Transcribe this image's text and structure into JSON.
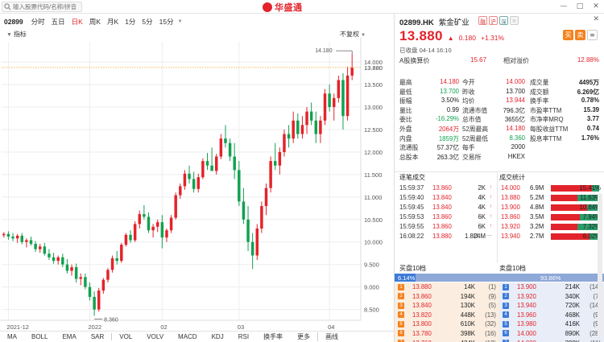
{
  "search": {
    "placeholder": "输入股票代码/名称/拼音"
  },
  "logo": {
    "text": "华盛通"
  },
  "window_controls": {
    "minimize": "—",
    "maximize": "□",
    "close": "✕"
  },
  "toolbar": {
    "code": "02899",
    "tabs": [
      "分时",
      "五日",
      "日K",
      "周K",
      "月K",
      "1分",
      "5分",
      "15分"
    ],
    "active_tab": "日K"
  },
  "subbar": {
    "tag": "指标",
    "adjust": "不复权"
  },
  "chart_data": {
    "type": "candlestick",
    "y_ticks": [
      8.5,
      9.0,
      9.5,
      10.0,
      10.5,
      11.0,
      11.5,
      12.0,
      12.5,
      13.0,
      13.5,
      14.0
    ],
    "ylim": [
      8.26,
      14.45
    ],
    "x_labels": [
      {
        "label": "2021-12",
        "i": 1
      },
      {
        "label": "2022",
        "i": 19
      },
      {
        "label": "02",
        "i": 35
      },
      {
        "label": "03",
        "i": 52
      },
      {
        "label": "04",
        "i": 72
      }
    ],
    "annotations": {
      "high": "14.180",
      "low": "8.360",
      "last": "13.880"
    },
    "candles": [
      [
        10.15,
        10.22,
        10.1,
        10.18
      ],
      [
        10.18,
        10.24,
        10.05,
        10.12
      ],
      [
        10.12,
        10.2,
        10.02,
        10.08
      ],
      [
        10.08,
        10.18,
        9.98,
        10.14
      ],
      [
        10.14,
        10.2,
        9.95,
        10.0
      ],
      [
        10.0,
        10.08,
        9.88,
        10.04
      ],
      [
        10.04,
        10.12,
        9.92,
        9.96
      ],
      [
        9.96,
        10.02,
        9.78,
        9.84
      ],
      [
        9.84,
        9.96,
        9.76,
        9.9
      ],
      [
        9.9,
        9.98,
        9.7,
        9.74
      ],
      [
        9.74,
        9.84,
        9.6,
        9.66
      ],
      [
        9.66,
        9.76,
        9.52,
        9.58
      ],
      [
        9.58,
        9.7,
        9.5,
        9.66
      ],
      [
        9.66,
        9.74,
        9.44,
        9.5
      ],
      [
        9.5,
        9.62,
        9.3,
        9.36
      ],
      [
        9.36,
        9.5,
        9.25,
        9.44
      ],
      [
        9.44,
        9.52,
        9.1,
        9.18
      ],
      [
        9.18,
        9.3,
        9.04,
        9.22
      ],
      [
        9.22,
        9.3,
        8.95,
        9.0
      ],
      [
        9.0,
        9.1,
        8.7,
        8.78
      ],
      [
        8.78,
        8.9,
        8.36,
        8.5
      ],
      [
        8.5,
        8.98,
        8.45,
        8.92
      ],
      [
        8.92,
        9.2,
        8.85,
        9.16
      ],
      [
        9.16,
        9.42,
        9.1,
        9.38
      ],
      [
        9.38,
        9.7,
        9.32,
        9.64
      ],
      [
        9.64,
        9.8,
        9.5,
        9.58
      ],
      [
        9.58,
        9.98,
        9.54,
        9.94
      ],
      [
        9.94,
        10.2,
        9.9,
        10.16
      ],
      [
        10.16,
        10.26,
        9.98,
        10.04
      ],
      [
        10.04,
        10.46,
        10.0,
        10.4
      ],
      [
        10.4,
        10.7,
        10.3,
        10.62
      ],
      [
        10.62,
        10.82,
        10.5,
        10.56
      ],
      [
        10.56,
        10.66,
        10.2,
        10.26
      ],
      [
        10.26,
        10.4,
        10.1,
        10.34
      ],
      [
        10.34,
        10.5,
        10.22,
        10.44
      ],
      [
        10.44,
        10.6,
        9.86,
        10.1
      ],
      [
        10.1,
        10.3,
        10.0,
        10.26
      ],
      [
        10.26,
        10.6,
        10.2,
        10.54
      ],
      [
        10.54,
        11.1,
        10.5,
        11.04
      ],
      [
        11.04,
        11.3,
        10.96,
        11.24
      ],
      [
        11.24,
        11.6,
        11.16,
        11.52
      ],
      [
        11.52,
        11.7,
        11.3,
        11.4
      ],
      [
        11.4,
        11.56,
        11.1,
        11.18
      ],
      [
        11.18,
        11.52,
        11.1,
        11.44
      ],
      [
        11.44,
        11.86,
        11.4,
        11.8
      ],
      [
        11.8,
        11.98,
        11.6,
        11.7
      ],
      [
        11.7,
        12.1,
        11.6,
        11.58
      ],
      [
        11.58,
        11.96,
        11.5,
        11.9
      ],
      [
        11.9,
        12.4,
        11.84,
        12.3
      ],
      [
        12.3,
        12.6,
        12.1,
        12.2
      ],
      [
        12.2,
        12.3,
        11.8,
        11.9
      ],
      [
        11.9,
        12.2,
        11.4,
        11.6
      ],
      [
        11.6,
        11.8,
        10.8,
        10.9
      ],
      [
        10.9,
        11.2,
        10.4,
        10.5
      ],
      [
        10.5,
        10.8,
        9.8,
        10.0
      ],
      [
        10.0,
        10.2,
        9.4,
        9.7
      ],
      [
        9.7,
        10.4,
        9.6,
        10.3
      ],
      [
        10.3,
        10.9,
        10.2,
        10.8
      ],
      [
        10.8,
        11.3,
        10.6,
        11.2
      ],
      [
        11.2,
        11.9,
        11.1,
        11.8
      ],
      [
        11.8,
        12.2,
        11.6,
        11.7
      ],
      [
        11.7,
        12.1,
        11.5,
        12.0
      ],
      [
        12.0,
        12.5,
        11.9,
        12.4
      ],
      [
        12.4,
        12.6,
        12.1,
        12.3
      ],
      [
        12.3,
        12.9,
        12.2,
        12.7
      ],
      [
        12.7,
        12.86,
        12.3,
        12.4
      ],
      [
        12.4,
        12.8,
        12.3,
        12.6
      ],
      [
        12.6,
        13.0,
        12.4,
        12.9
      ],
      [
        12.9,
        13.1,
        12.6,
        12.7
      ],
      [
        12.7,
        12.9,
        12.2,
        12.4
      ],
      [
        12.4,
        12.8,
        12.2,
        12.7
      ],
      [
        12.7,
        13.4,
        12.6,
        13.3
      ],
      [
        13.3,
        13.5,
        12.9,
        13.0
      ],
      [
        13.0,
        13.3,
        12.7,
        13.2
      ],
      [
        13.2,
        13.7,
        13.1,
        13.6
      ],
      [
        13.6,
        13.75,
        12.5,
        12.8
      ],
      [
        12.8,
        13.9,
        12.7,
        13.7
      ],
      [
        13.7,
        14.18,
        13.6,
        13.88
      ]
    ]
  },
  "indicators": [
    "MA",
    "BOLL",
    "EMA",
    "SAR",
    "VOL",
    "VOLV",
    "MACD",
    "KDJ",
    "RSI",
    "换手率",
    "更多",
    "画线"
  ],
  "stock": {
    "code": "02899.HK",
    "name": "紫金矿业",
    "icons": [
      "融",
      "沪",
      "深",
      "☆"
    ],
    "price": "13.880",
    "change": "0.180",
    "change_pct": "+1.31%",
    "status": "已收盘 04-14 16:10",
    "buttons": [
      "买",
      "卖"
    ],
    "a_label": "A股换算价",
    "a_value": "15.67",
    "premium_label": "相对溢价",
    "premium_value": "12.88%"
  },
  "quote_rows": [
    {
      "l1": "最高",
      "v1": "14.180",
      "c1": "red",
      "l2": "今开",
      "v2": "14.000",
      "c2": "red",
      "l3": "成交量",
      "v3": "4495万"
    },
    {
      "l1": "最低",
      "v1": "13.700",
      "c1": "green",
      "l2": "昨收",
      "v2": "13.700",
      "c2": "dark",
      "l3": "成交额",
      "v3": "6.269亿"
    },
    {
      "l1": "振幅",
      "v1": "3.50%",
      "c1": "dark",
      "l2": "均价",
      "v2": "13.944",
      "c2": "red",
      "l3": "换手率",
      "v3": "0.78%"
    },
    {
      "l1": "量比",
      "v1": "0.99",
      "c1": "dark",
      "l2": "流通市值",
      "v2": "796.3亿",
      "c2": "dark",
      "l3": "市盈率TTM",
      "v3": "15.39"
    },
    {
      "l1": "委比",
      "v1": "-16.29%",
      "c1": "green",
      "l2": "总市值",
      "v2": "3655亿",
      "c2": "dark",
      "l3": "市净率MRQ",
      "v3": "3.77"
    },
    {
      "l1": "外盘",
      "v1": "2064万",
      "c1": "red",
      "l2": "52周最高",
      "v2": "14.180",
      "c2": "red",
      "l3": "每股收益TTM",
      "v3": "0.74"
    },
    {
      "l1": "内盘",
      "v1": "1859万",
      "c1": "green",
      "l2": "52周最低",
      "v2": "8.360",
      "c2": "green",
      "l3": "股息率TTM",
      "v3": "1.76%"
    },
    {
      "l1": "流通股",
      "v1": "57.37亿",
      "c1": "dark",
      "l2": "每手",
      "v2": "2000",
      "c2": "dark",
      "l3": "",
      "v3": ""
    },
    {
      "l1": "总股本",
      "v1": "263.3亿",
      "c1": "dark",
      "l2": "交易所",
      "v2": "HKEX",
      "c2": "dark",
      "l3": "",
      "v3": ""
    }
  ],
  "trades_title": "逐笔成交",
  "trades": [
    {
      "time": "15:59:37",
      "price": "13.860",
      "vol": "2K",
      "dir": "↑"
    },
    {
      "time": "15:59:40",
      "price": "13.840",
      "vol": "4K",
      "dir": "↑"
    },
    {
      "time": "15:59:45",
      "price": "13.840",
      "vol": "4K",
      "dir": "↑"
    },
    {
      "time": "15:59:53",
      "price": "13.860",
      "vol": "6K",
      "dir": "↑"
    },
    {
      "time": "15:59:55",
      "price": "13.860",
      "vol": "6K",
      "dir": "↑"
    },
    {
      "time": "16:08:22",
      "price": "13.880",
      "vol": "1.824M",
      "dir": "—",
      "flag": "U"
    }
  ],
  "stats_title": "成交统计",
  "stats": [
    {
      "price": "14.000",
      "vol": "6.9M",
      "pct": "15.41%",
      "frac": 0.85
    },
    {
      "price": "13.880",
      "vol": "5.2M",
      "pct": "11.63%",
      "frac": 0.55
    },
    {
      "price": "13.900",
      "vol": "4.8M",
      "pct": "10.84%",
      "frac": 0.75
    },
    {
      "price": "13.860",
      "vol": "3.5M",
      "pct": "7.94%",
      "frac": 0.6
    },
    {
      "price": "13.920",
      "vol": "3.2M",
      "pct": "7.32%",
      "frac": 0.55
    },
    {
      "price": "13.940",
      "vol": "2.7M",
      "pct": "6.02%",
      "frac": 0.8
    }
  ],
  "book": {
    "bid_title": "买盘10档",
    "ask_title": "卖盘10档",
    "bid_pct": "6.14%",
    "ask_pct": "93.86%",
    "bid_frac": 0.0614,
    "bids": [
      {
        "lv": "1",
        "price": "13.880",
        "size": "14K",
        "count": "(1)"
      },
      {
        "lv": "2",
        "price": "13.860",
        "size": "194K",
        "count": "(9)"
      },
      {
        "lv": "3",
        "price": "13.840",
        "size": "130K",
        "count": "(5)"
      },
      {
        "lv": "4",
        "price": "13.820",
        "size": "448K",
        "count": "(13)"
      },
      {
        "lv": "5",
        "price": "13.800",
        "size": "610K",
        "count": "(32)"
      },
      {
        "lv": "6",
        "price": "13.780",
        "size": "398K",
        "count": "(16)"
      },
      {
        "lv": "7",
        "price": "13.760",
        "size": "434K",
        "count": "(12)"
      }
    ],
    "asks": [
      {
        "lv": "1",
        "price": "13.900",
        "size": "214K",
        "count": "(14)"
      },
      {
        "lv": "2",
        "price": "13.920",
        "size": "340K",
        "count": "(7)"
      },
      {
        "lv": "3",
        "price": "13.940",
        "size": "720K",
        "count": "(14)"
      },
      {
        "lv": "4",
        "price": "13.960",
        "size": "468K",
        "count": "(9)"
      },
      {
        "lv": "5",
        "price": "13.980",
        "size": "416K",
        "count": "(9)"
      },
      {
        "lv": "6",
        "price": "14.000",
        "size": "890K",
        "count": "(28)"
      },
      {
        "lv": "7",
        "price": "14.020",
        "size": "398K",
        "count": "(11)"
      }
    ]
  },
  "colors": {
    "up": "#e3232b",
    "down": "#12a150",
    "accent": "#e3232b"
  }
}
